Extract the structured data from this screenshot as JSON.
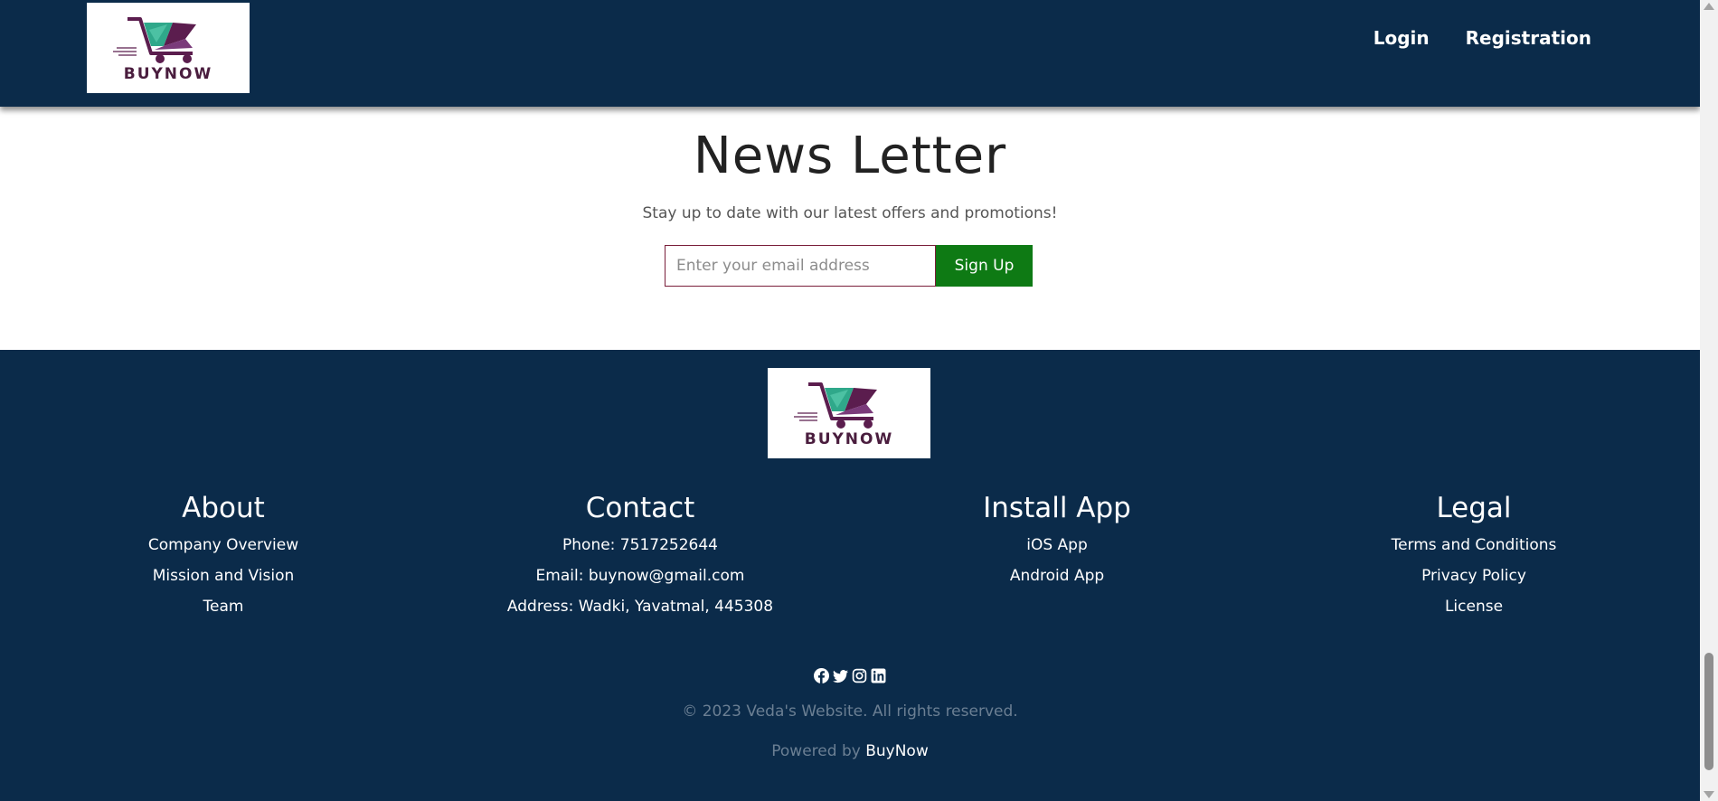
{
  "header": {
    "logo_text": "BUYNOW",
    "nav": {
      "login": "Login",
      "registration": "Registration"
    }
  },
  "newsletter": {
    "title": "News Letter",
    "subtitle": "Stay up to date with our latest offers and promotions!",
    "email_placeholder": "Enter your email address",
    "signup_label": "Sign Up"
  },
  "footer": {
    "logo_text": "BUYNOW",
    "about": {
      "title": "About",
      "links": [
        "Company Overview",
        "Mission and Vision",
        "Team"
      ]
    },
    "contact": {
      "title": "Contact",
      "lines": [
        "Phone: 7517252644",
        "Email: buynow@gmail.com",
        "Address: Wadki, Yavatmal, 445308"
      ]
    },
    "install": {
      "title": "Install App",
      "links": [
        "iOS App",
        "Android App"
      ]
    },
    "legal": {
      "title": "Legal",
      "links": [
        "Terms and Conditions",
        "Privacy Policy",
        "License"
      ]
    },
    "social_icons": [
      "facebook-icon",
      "twitter-icon",
      "instagram-icon",
      "linkedin-icon"
    ],
    "copyright": "© 2023 Veda's Website. All rights reserved.",
    "powered_prefix": "Powered by",
    "powered_brand": "BuyNow"
  },
  "colors": {
    "navy": "#0b2b4a",
    "signup_green": "#0e7a14",
    "logo_purple": "#5b1d4e",
    "logo_teal": "#2fa88a"
  }
}
